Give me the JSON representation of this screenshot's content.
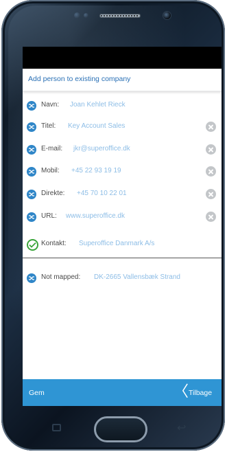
{
  "header": {
    "title": "Add person to existing company"
  },
  "fields": [
    {
      "label": "Navn:",
      "value": "Joan Kehlet Rieck",
      "icon": "shuffle-icon",
      "clearable": false
    },
    {
      "label": "Titel:",
      "value": "Key Account Sales",
      "icon": "shuffle-icon",
      "clearable": true
    },
    {
      "label": "E-mail:",
      "value": "jkr@superoffice.dk",
      "icon": "shuffle-icon",
      "clearable": true
    },
    {
      "label": "Mobil:",
      "value": "+45 22 93 19 19",
      "icon": "shuffle-icon",
      "clearable": true
    },
    {
      "label": "Direkte:",
      "value": "+45 70 10 22 01",
      "icon": "shuffle-icon",
      "clearable": true
    },
    {
      "label": "URL:",
      "value": "www.superoffice.dk",
      "icon": "shuffle-icon",
      "clearable": true
    }
  ],
  "contact": {
    "label": "Kontakt:",
    "value": "Superoffice Danmark A/s",
    "icon": "check-circle-icon"
  },
  "unmapped": {
    "label": "Not mapped:",
    "value": "DK-2665 Vallensbæk Strand",
    "icon": "shuffle-icon"
  },
  "footer": {
    "save_label": "Gem",
    "back_label": "Tilbage",
    "separator_icon": "chevron-left-icon"
  },
  "colors": {
    "accent": "#2f86c8",
    "bar": "#2f95d4",
    "value_text": "#8dbde6",
    "clear_button": "#c3c6c9",
    "check": "#3aa53a"
  }
}
